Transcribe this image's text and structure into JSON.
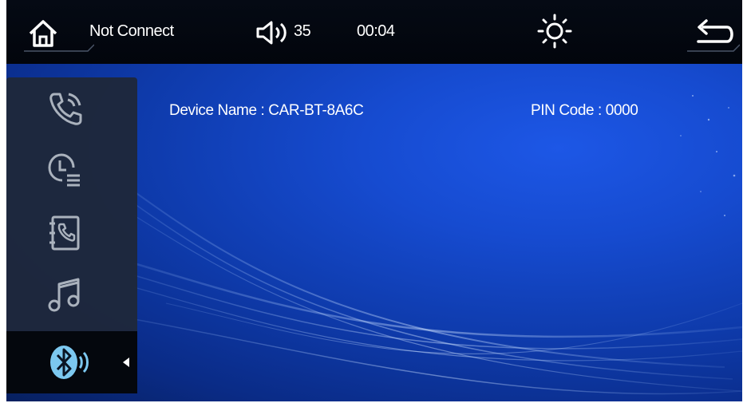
{
  "topbar": {
    "connection_status": "Not Connect",
    "volume_value": "35",
    "time": "00:04",
    "icons": [
      "home-icon",
      "speaker-volume-icon",
      "brightness-sun-icon",
      "back-arrow-icon"
    ]
  },
  "device_info": {
    "device_name": "Device Name : CAR-BT-8A6C",
    "pin_code": "PIN Code : 0000"
  },
  "sidebar": {
    "items": [
      {
        "icon": "phone-dialer-icon",
        "active": false
      },
      {
        "icon": "call-history-icon",
        "active": false
      },
      {
        "icon": "phonebook-icon",
        "active": false
      },
      {
        "icon": "bluetooth-music-icon",
        "active": false
      },
      {
        "icon": "bluetooth-settings-icon",
        "active": true
      }
    ]
  },
  "colors": {
    "topbar_bg": "#03070f",
    "sidebar_bg": "#1e283a",
    "active_icon": "#7cc8f0",
    "icon_gray": "#aab2bd",
    "background_blue": "#1448cc"
  }
}
